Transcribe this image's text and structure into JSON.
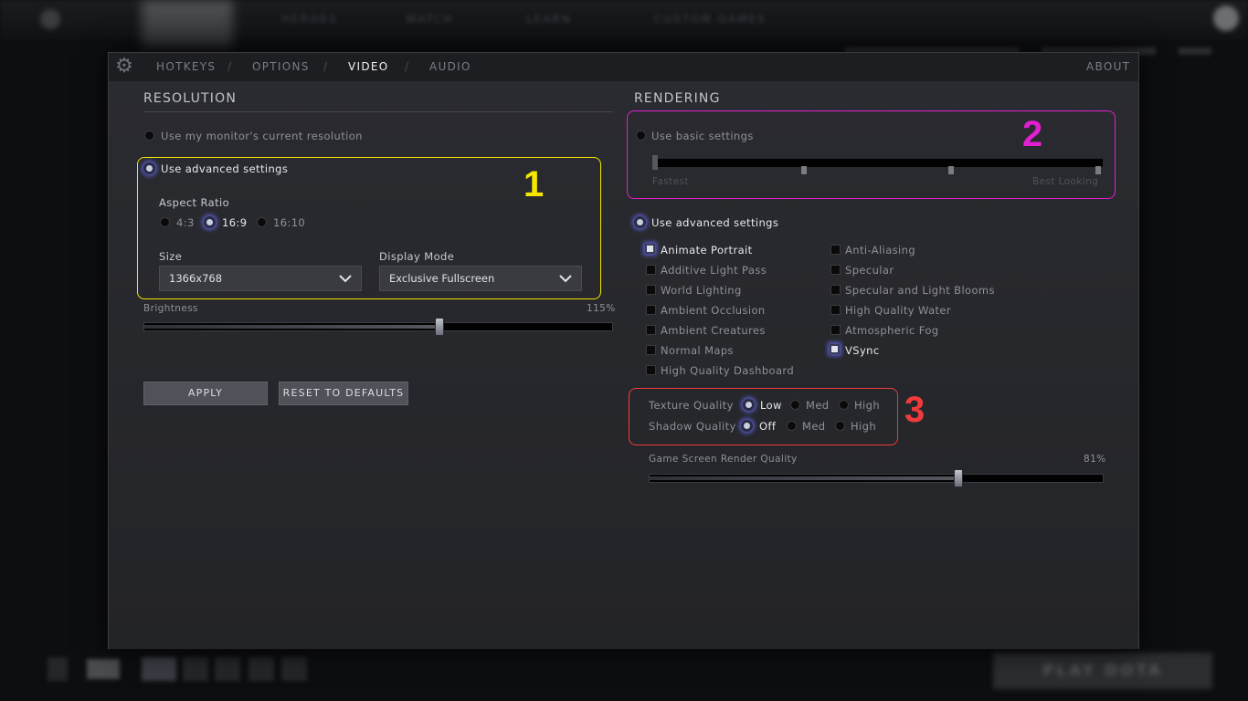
{
  "background": {
    "nav_items": [
      "HEROES",
      "WATCH",
      "LEARN",
      "CUSTOM GAMES"
    ],
    "play_button": "PLAY DOTA"
  },
  "tabs": {
    "hotkeys": "HOTKEYS",
    "options": "OPTIONS",
    "video": "VIDEO",
    "audio": "AUDIO",
    "separator": "/",
    "about": "ABOUT"
  },
  "resolution": {
    "title": "RESOLUTION",
    "use_monitor": "Use my monitor's current resolution",
    "use_advanced": "Use advanced settings",
    "aspect_ratio_label": "Aspect Ratio",
    "aspect_options": [
      "4:3",
      "16:9",
      "16:10"
    ],
    "aspect_selected": "16:9",
    "size_label": "Size",
    "size_value": "1366x768",
    "display_mode_label": "Display Mode",
    "display_mode_value": "Exclusive Fullscreen",
    "brightness_label": "Brightness",
    "brightness_value": "115%",
    "brightness_fraction": 0.63,
    "apply": "APPLY",
    "reset": "RESET TO DEFAULTS"
  },
  "rendering": {
    "title": "RENDERING",
    "use_basic": "Use basic settings",
    "basic_min_label": "Fastest",
    "basic_max_label": "Best Looking",
    "use_advanced": "Use advanced settings",
    "checkboxes_left": [
      {
        "label": "Animate Portrait",
        "checked": true
      },
      {
        "label": "Additive Light Pass",
        "checked": false
      },
      {
        "label": "World Lighting",
        "checked": false
      },
      {
        "label": "Ambient Occlusion",
        "checked": false
      },
      {
        "label": "Ambient Creatures",
        "checked": false
      },
      {
        "label": "Normal Maps",
        "checked": false
      },
      {
        "label": "High Quality Dashboard",
        "checked": false
      }
    ],
    "checkboxes_right": [
      {
        "label": "Anti-Aliasing",
        "checked": false
      },
      {
        "label": "Specular",
        "checked": false
      },
      {
        "label": "Specular and Light Blooms",
        "checked": false
      },
      {
        "label": "High Quality Water",
        "checked": false
      },
      {
        "label": "Atmospheric Fog",
        "checked": false
      },
      {
        "label": "VSync",
        "checked": true
      }
    ],
    "texture_quality_label": "Texture Quality",
    "texture_options": [
      "Low",
      "Med",
      "High"
    ],
    "texture_selected": "Low",
    "shadow_quality_label": "Shadow Quality",
    "shadow_options": [
      "Off",
      "Med",
      "High"
    ],
    "shadow_selected": "Off",
    "render_quality_label": "Game Screen Render Quality",
    "render_quality_value": "81%",
    "render_quality_fraction": 0.68
  },
  "annotations": {
    "one": {
      "number": "1",
      "color": "#f5e600"
    },
    "two": {
      "number": "2",
      "color": "#e020d0"
    },
    "three": {
      "number": "3",
      "color": "#ef3b3b"
    }
  }
}
